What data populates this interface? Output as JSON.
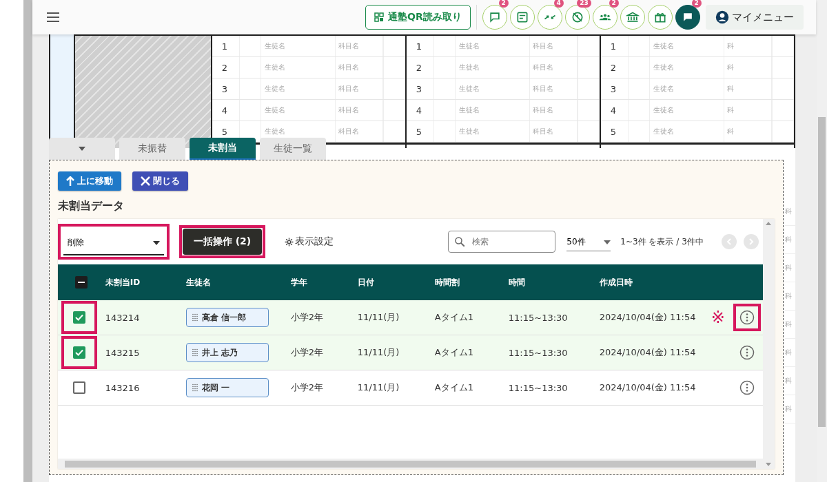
{
  "header": {
    "qr_button": "通塾QR読み取り",
    "icon_buttons": [
      {
        "badge": "2",
        "active": false
      },
      {
        "active": false
      },
      {
        "badge": "4",
        "active": false
      },
      {
        "badge": "23",
        "active": false
      },
      {
        "badge": "2",
        "active": false
      },
      {
        "active": false
      },
      {
        "active": false
      },
      {
        "badge": "2",
        "active": true
      }
    ],
    "my_menu": "マイメニュー"
  },
  "schedule": {
    "columns": [
      {
        "rows": [
          {
            "number": "1",
            "student": "生徒名",
            "subject": "科目名"
          },
          {
            "number": "2",
            "student": "生徒名",
            "subject": "科目名"
          },
          {
            "number": "3",
            "student": "生徒名",
            "subject": "科目名"
          },
          {
            "number": "4",
            "student": "生徒名",
            "subject": "科目名"
          },
          {
            "number": "5",
            "student": "生徒名",
            "subject": "科目名"
          }
        ]
      },
      {
        "rows": [
          {
            "number": "1",
            "student": "生徒名",
            "subject": "科目名"
          },
          {
            "number": "2",
            "student": "生徒名",
            "subject": "科目名"
          },
          {
            "number": "3",
            "student": "生徒名",
            "subject": "科目名"
          },
          {
            "number": "4",
            "student": "生徒名",
            "subject": "科目名"
          },
          {
            "number": "5",
            "student": "生徒名",
            "subject": "科目名"
          }
        ]
      },
      {
        "rows": [
          {
            "number": "1",
            "student": "生徒名",
            "subject": "科"
          },
          {
            "number": "2",
            "student": "生徒名",
            "subject": "科"
          },
          {
            "number": "3",
            "student": "生徒名",
            "subject": "科"
          },
          {
            "number": "4",
            "student": "生徒名",
            "subject": "科"
          },
          {
            "number": "5",
            "student": "生徒名",
            "subject": "科"
          }
        ]
      }
    ],
    "edge_cells": [
      "科",
      "科",
      "科",
      "科",
      "科",
      "科",
      "科",
      "科"
    ]
  },
  "tabs": [
    {
      "kind": "dropdown",
      "selected": false
    },
    {
      "label": "未振替",
      "kind": "tab",
      "selected": false
    },
    {
      "label": "未割当",
      "kind": "tab",
      "selected": true
    },
    {
      "label": "生徒一覧",
      "kind": "tab",
      "selected": false
    }
  ],
  "panel": {
    "move_up_button": "上に移動",
    "close_button": "閉じる",
    "title": "未割当データ",
    "action_select": {
      "value": "削除",
      "highlighted": true
    },
    "bulk_button": {
      "label": "一括操作 (2)",
      "highlighted": true
    },
    "display_settings": "表示設定",
    "search": {
      "placeholder": "検索"
    },
    "per_page": "50件",
    "range": "1~3件 を表示 / 3件中",
    "table": {
      "header_checkbox_indeterminate": true,
      "columns": [
        "未割当ID",
        "生徒名",
        "学年",
        "日付",
        "時間割",
        "時間",
        "作成日時"
      ],
      "rows": [
        {
          "selected": true,
          "checkbox_highlighted": true,
          "id": "143214",
          "student": "高倉 信一郎",
          "grade": "小学2年",
          "date": "11/11(月)",
          "slot": "Aタイム1",
          "time": "11:15~13:30",
          "created": "2024/10/04(金) 11:54",
          "note_mark": "※",
          "menu_highlighted": true
        },
        {
          "selected": true,
          "checkbox_highlighted": true,
          "id": "143215",
          "student": "井上 志乃",
          "grade": "小学2年",
          "date": "11/11(月)",
          "slot": "Aタイム1",
          "time": "11:15~13:30",
          "created": "2024/10/04(金) 11:54",
          "menu_highlighted": false
        },
        {
          "selected": false,
          "checkbox_highlighted": false,
          "id": "143216",
          "student": "花岡 一",
          "grade": "小学2年",
          "date": "11/11(月)",
          "slot": "Aタイム1",
          "time": "11:15~13:30",
          "created": "2024/10/04(金) 11:54",
          "menu_highlighted": false
        }
      ]
    }
  }
}
